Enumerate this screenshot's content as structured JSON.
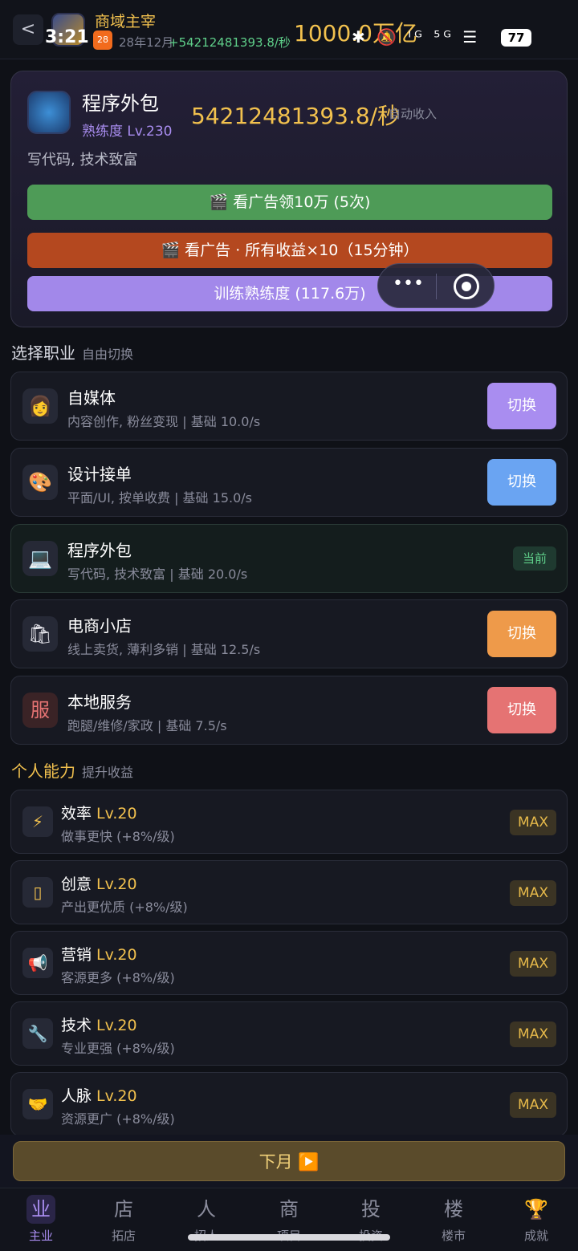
{
  "statusbar": {
    "time": "3:21",
    "icons": "✱ 🔕 ᴵᴳ ⁵ᴳ ☰",
    "battery": "77"
  },
  "header": {
    "back": "<",
    "app_name": "商域主宰",
    "sub_badge": "28",
    "sub_date": "28年12月",
    "rate": "+54212481393.8/秒",
    "money": "1000.0万亿"
  },
  "hero": {
    "title": "程序外包",
    "level": "熟练度 Lv.230",
    "income": "54212481393.8/秒",
    "income_label": "自动收入",
    "desc": "写代码, 技术致富",
    "btn_ad_reward": "🎬 看广告领10万 (5次)",
    "btn_ad_multiplier": "🎬 看广告 · 所有收益×10（15分钟）",
    "btn_train": "训练熟练度 (117.6万)"
  },
  "capsule": {
    "dots": "•••"
  },
  "jobs_section": {
    "title": "选择职业",
    "subtitle": "自由切换"
  },
  "jobs": [
    {
      "icon": "👩",
      "name": "自媒体",
      "desc": "内容创作, 粉丝变现 | 基础 10.0/s",
      "action": "切换",
      "color": "#a98df0"
    },
    {
      "icon": "🎨",
      "name": "设计接单",
      "desc": "平面/UI, 按单收费 | 基础 15.0/s",
      "action": "切换",
      "color": "#6aa4f2"
    },
    {
      "icon": "💻",
      "name": "程序外包",
      "desc": "写代码, 技术致富 | 基础 20.0/s",
      "action": "当前",
      "color": "#5fd08a"
    },
    {
      "icon": "🛍",
      "name": "电商小店",
      "desc": "线上卖货, 薄利多销 | 基础 12.5/s",
      "action": "切换",
      "color": "#ee9a4a"
    },
    {
      "icon": "服",
      "name": "本地服务",
      "desc": "跑腿/维修/家政 | 基础 7.5/s",
      "action": "切换",
      "color": "#e57373"
    }
  ],
  "skills_section": {
    "title": "个人能力",
    "subtitle": "提升收益"
  },
  "skills": [
    {
      "icon": "⚡",
      "name": "效率",
      "level": "Lv.20",
      "desc": "做事更快 (+8%/级)",
      "badge": "MAX"
    },
    {
      "icon": "▯",
      "name": "创意",
      "level": "Lv.20",
      "desc": "产出更优质 (+8%/级)",
      "badge": "MAX"
    },
    {
      "icon": "📢",
      "name": "营销",
      "level": "Lv.20",
      "desc": "客源更多 (+8%/级)",
      "badge": "MAX"
    },
    {
      "icon": "🔧",
      "name": "技术",
      "level": "Lv.20",
      "desc": "专业更强 (+8%/级)",
      "badge": "MAX"
    },
    {
      "icon": "🤝",
      "name": "人脉",
      "level": "Lv.20",
      "desc": "资源更广 (+8%/级)",
      "badge": "MAX"
    }
  ],
  "next_month": "下月 ▶️",
  "nav": [
    {
      "icon": "业",
      "label": "主业"
    },
    {
      "icon": "店",
      "label": "拓店"
    },
    {
      "icon": "人",
      "label": "招人"
    },
    {
      "icon": "商",
      "label": "项目"
    },
    {
      "icon": "投",
      "label": "投资"
    },
    {
      "icon": "楼",
      "label": "楼市"
    },
    {
      "icon": "🏆",
      "label": "成就"
    }
  ]
}
